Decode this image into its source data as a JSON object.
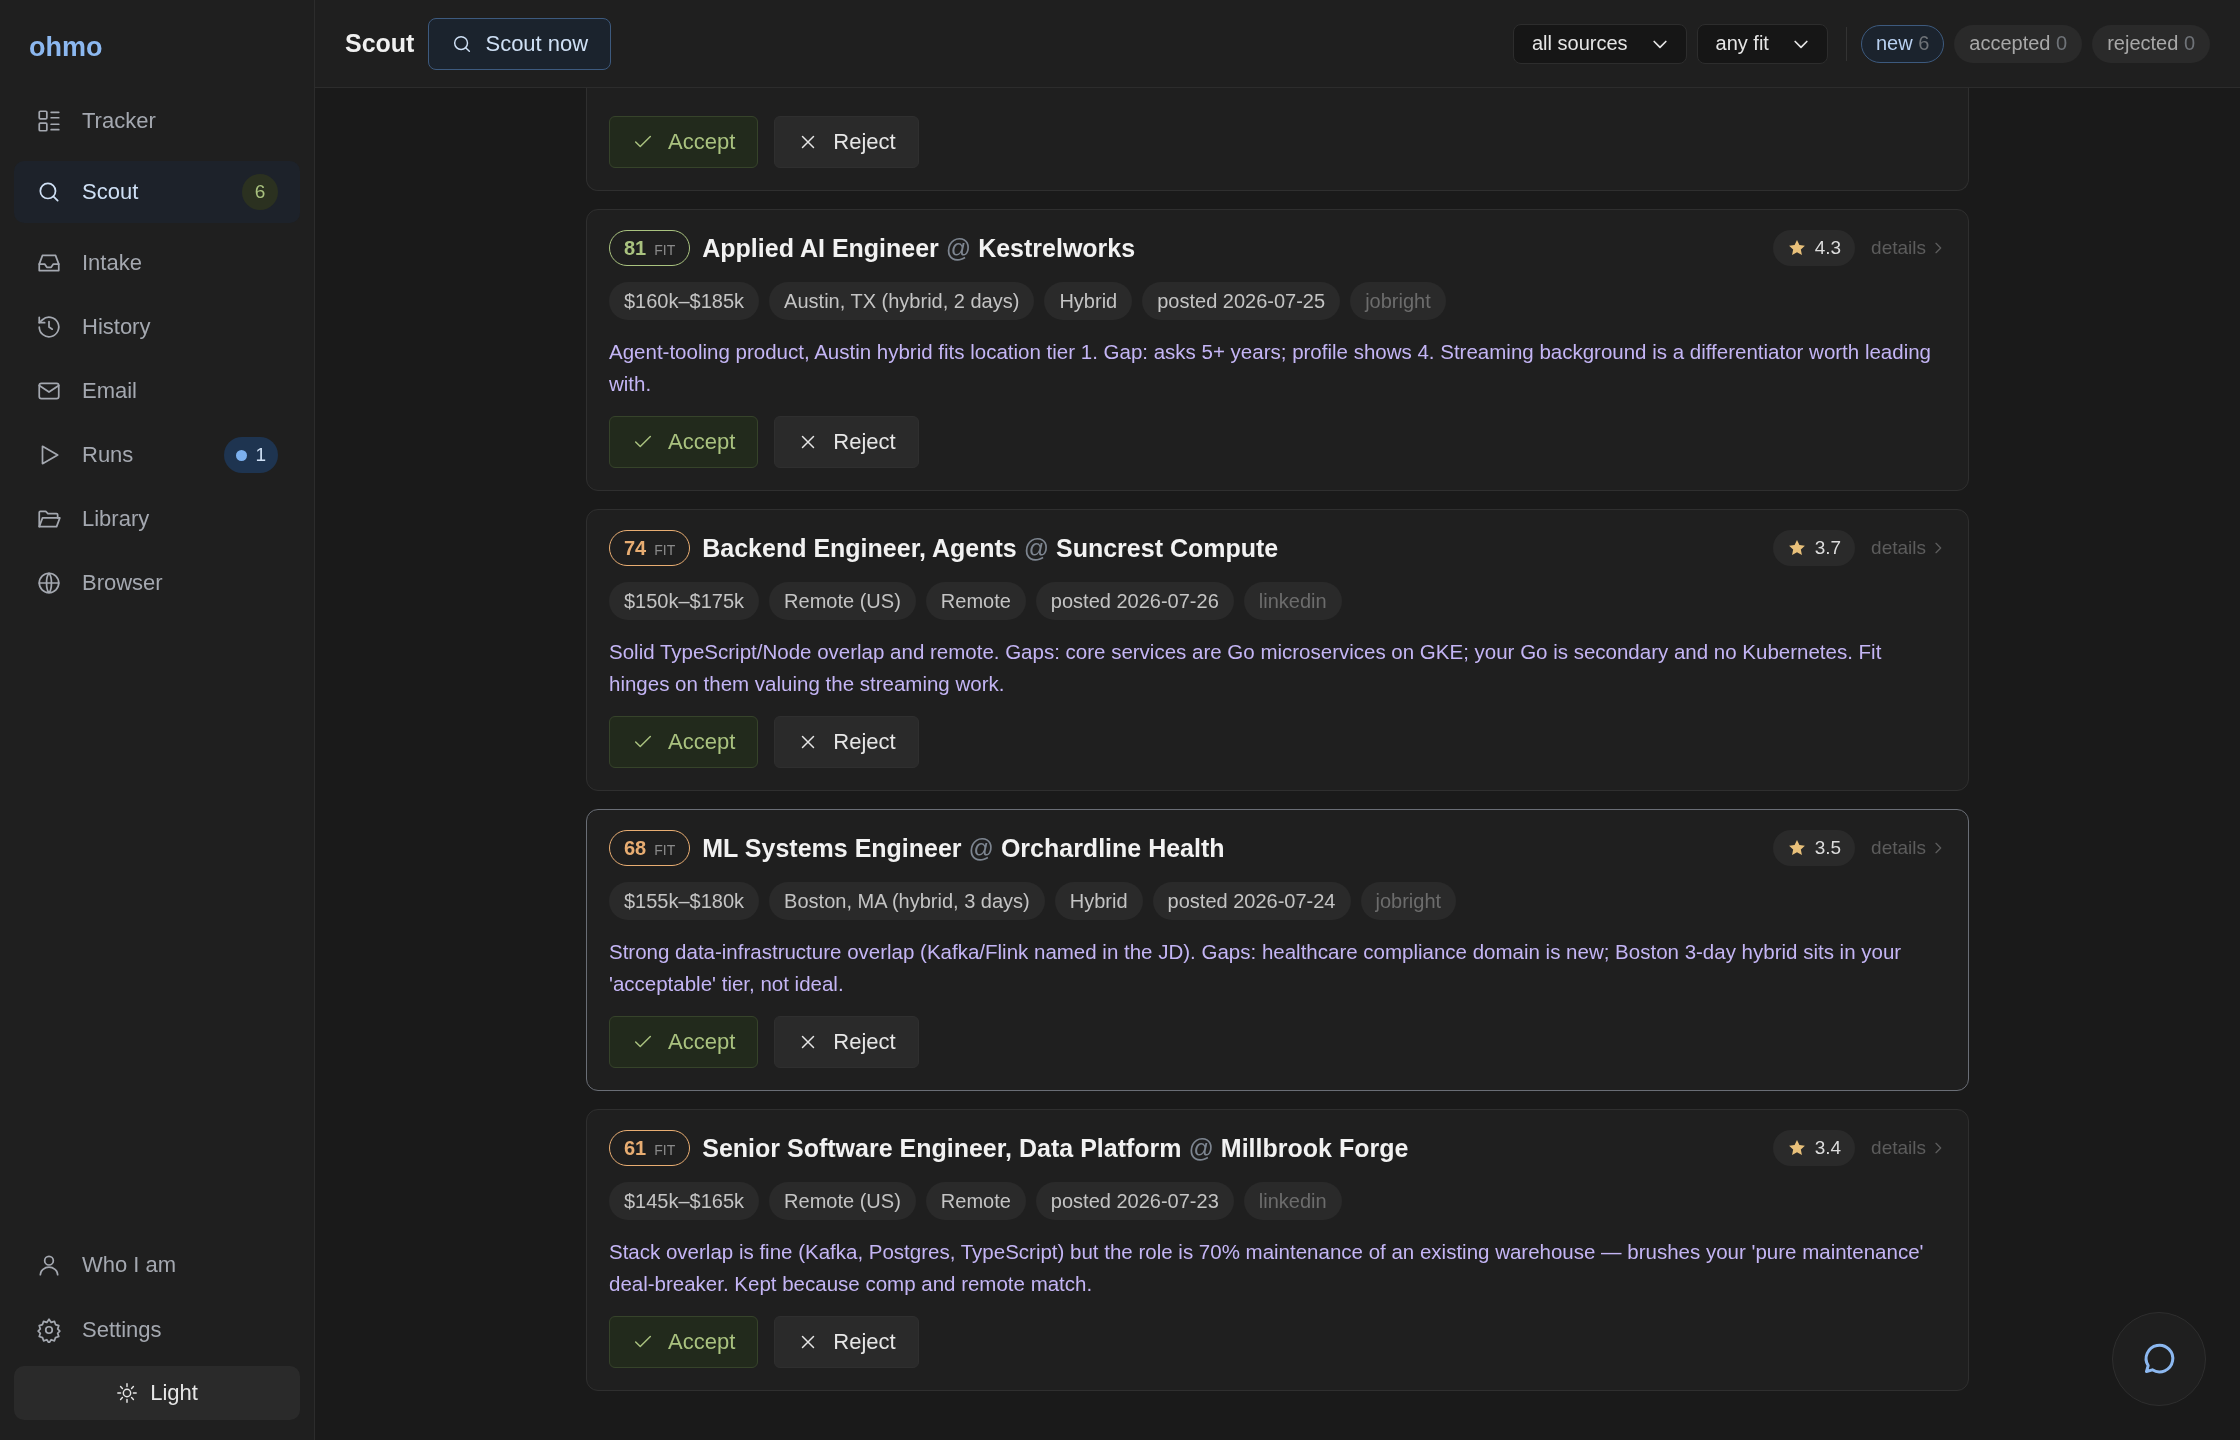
{
  "sidebar": {
    "logo": "ohmo",
    "items": [
      {
        "label": "Tracker",
        "selected": false
      },
      {
        "label": "Scout",
        "selected": true,
        "badge": {
          "text": "6",
          "kind": "count"
        }
      },
      {
        "label": "Intake",
        "selected": false
      },
      {
        "label": "History",
        "selected": false
      },
      {
        "label": "Email",
        "selected": false
      },
      {
        "label": "Runs",
        "selected": false,
        "badge": {
          "text": "1",
          "kind": "live"
        }
      },
      {
        "label": "Library",
        "selected": false
      },
      {
        "label": "Browser",
        "selected": false
      }
    ],
    "footer_items": [
      {
        "label": "Who I am"
      },
      {
        "label": "Settings"
      }
    ],
    "theme_button": "Light"
  },
  "header": {
    "title": "Scout",
    "action": "Scout now",
    "filters": [
      "all sources",
      "any fit"
    ],
    "status_tabs": [
      {
        "label": "new",
        "count": "6",
        "selected": true
      },
      {
        "label": "accepted",
        "count": "0",
        "selected": false
      },
      {
        "label": "rejected",
        "count": "0",
        "selected": false
      }
    ]
  },
  "cards": [
    {
      "partial": true,
      "selected": false,
      "accept": "Accept",
      "reject": "Reject"
    },
    {
      "partial": false,
      "selected": false,
      "fit": {
        "score": "81",
        "label": "FIT",
        "color": "#a9c27f"
      },
      "role": "Applied AI Engineer",
      "separator": "@",
      "company": "Kestrelworks",
      "rating": "4.3",
      "details": "details",
      "tags": [
        {
          "text": "$160k–$185k",
          "kind": "fact"
        },
        {
          "text": "Austin, TX (hybrid, 2 days)",
          "kind": "fact"
        },
        {
          "text": "Hybrid",
          "kind": "fact"
        },
        {
          "text": "posted 2026-07-25",
          "kind": "fact"
        },
        {
          "text": "jobright",
          "kind": "source"
        }
      ],
      "summary": "Agent-tooling product, Austin hybrid fits location tier 1. Gap: asks 5+ years; profile shows 4. Streaming background is a differentiator worth leading with.",
      "accept": "Accept",
      "reject": "Reject"
    },
    {
      "partial": false,
      "selected": false,
      "fit": {
        "score": "74",
        "label": "FIT",
        "color": "#e8ad72"
      },
      "role": "Backend Engineer, Agents",
      "separator": "@",
      "company": "Suncrest Compute",
      "rating": "3.7",
      "details": "details",
      "tags": [
        {
          "text": "$150k–$175k",
          "kind": "fact"
        },
        {
          "text": "Remote (US)",
          "kind": "fact"
        },
        {
          "text": "Remote",
          "kind": "fact"
        },
        {
          "text": "posted 2026-07-26",
          "kind": "fact"
        },
        {
          "text": "linkedin",
          "kind": "source"
        }
      ],
      "summary": "Solid TypeScript/Node overlap and remote. Gaps: core services are Go microservices on GKE; your Go is secondary and no Kubernetes. Fit hinges on them valuing the streaming work.",
      "accept": "Accept",
      "reject": "Reject"
    },
    {
      "partial": false,
      "selected": true,
      "fit": {
        "score": "68",
        "label": "FIT",
        "color": "#e8ad72"
      },
      "role": "ML Systems Engineer",
      "separator": "@",
      "company": "Orchardline Health",
      "rating": "3.5",
      "details": "details",
      "tags": [
        {
          "text": "$155k–$180k",
          "kind": "fact"
        },
        {
          "text": "Boston, MA (hybrid, 3 days)",
          "kind": "fact"
        },
        {
          "text": "Hybrid",
          "kind": "fact"
        },
        {
          "text": "posted 2026-07-24",
          "kind": "fact"
        },
        {
          "text": "jobright",
          "kind": "source"
        }
      ],
      "summary": "Strong data-infrastructure overlap (Kafka/Flink named in the JD). Gaps: healthcare compliance domain is new; Boston 3-day hybrid sits in your 'acceptable' tier, not ideal.",
      "accept": "Accept",
      "reject": "Reject"
    },
    {
      "partial": false,
      "selected": false,
      "fit": {
        "score": "61",
        "label": "FIT",
        "color": "#e8ad72"
      },
      "role": "Senior Software Engineer, Data Platform",
      "separator": "@",
      "company": "Millbrook Forge",
      "rating": "3.4",
      "details": "details",
      "tags": [
        {
          "text": "$145k–$165k",
          "kind": "fact"
        },
        {
          "text": "Remote (US)",
          "kind": "fact"
        },
        {
          "text": "Remote",
          "kind": "fact"
        },
        {
          "text": "posted 2026-07-23",
          "kind": "fact"
        },
        {
          "text": "linkedin",
          "kind": "source"
        }
      ],
      "summary": "Stack overlap is fine (Kafka, Postgres, TypeScript) but the role is 70% maintenance of an existing warehouse — brushes your 'pure maintenance' deal-breaker. Kept because comp and remote match.",
      "accept": "Accept",
      "reject": "Reject"
    }
  ]
}
